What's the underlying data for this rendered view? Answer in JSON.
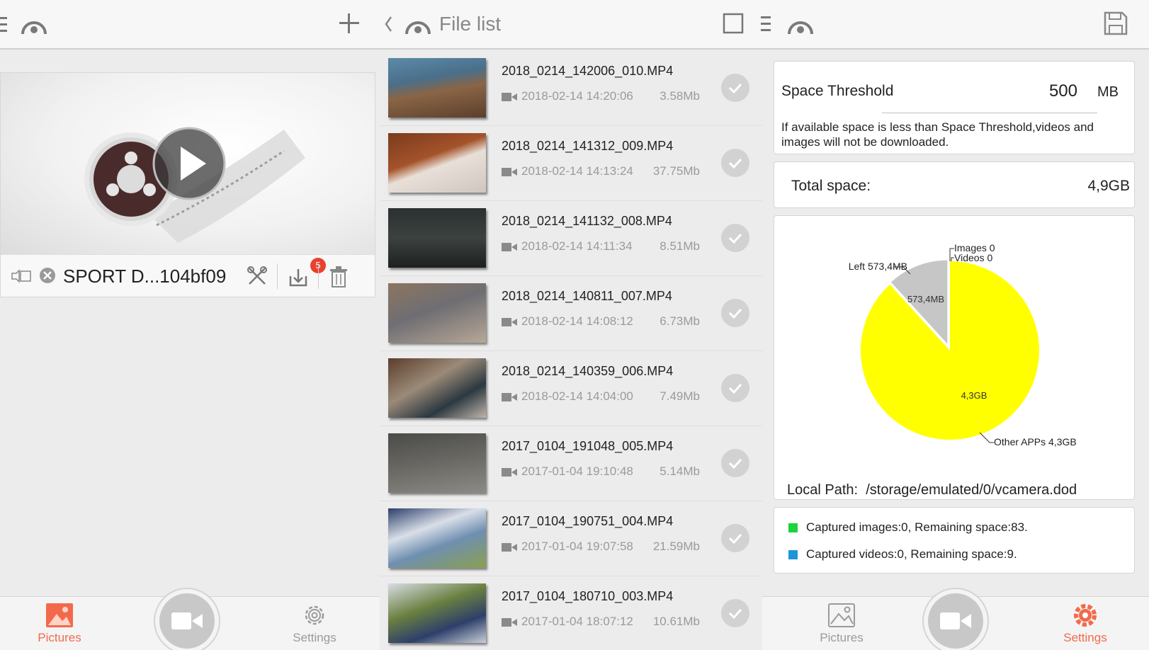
{
  "topbar": {
    "title": "File list"
  },
  "device": {
    "name": "SPORT D...104bf09",
    "badge_count": "5"
  },
  "files": [
    {
      "name": "2018_0214_142006_010.MP4",
      "date": "2018-02-14 14:20:06",
      "size": "3.58Mb"
    },
    {
      "name": "2018_0214_141312_009.MP4",
      "date": "2018-02-14 14:13:24",
      "size": "37.75Mb"
    },
    {
      "name": "2018_0214_141132_008.MP4",
      "date": "2018-02-14 14:11:34",
      "size": "8.51Mb"
    },
    {
      "name": "2018_0214_140811_007.MP4",
      "date": "2018-02-14 14:08:12",
      "size": "6.73Mb"
    },
    {
      "name": "2018_0214_140359_006.MP4",
      "date": "2018-02-14 14:04:00",
      "size": "7.49Mb"
    },
    {
      "name": "2017_0104_191048_005.MP4",
      "date": "2017-01-04 19:10:48",
      "size": "5.14Mb"
    },
    {
      "name": "2017_0104_190751_004.MP4",
      "date": "2017-01-04 19:07:58",
      "size": "21.59Mb"
    },
    {
      "name": "2017_0104_180710_003.MP4",
      "date": "2017-01-04 18:07:12",
      "size": "10.61Mb"
    }
  ],
  "settings": {
    "threshold_label": "Space Threshold",
    "threshold_value": "500",
    "threshold_unit": "MB",
    "threshold_desc": "If available space is less than Space Threshold,videos and images will not be downloaded.",
    "total_label": "Total space:",
    "total_value": "4,9GB",
    "local_path_label": "Local Path:",
    "local_path_value": "/storage/emulated/0/vcamera.dod",
    "legend_images": "Captured images:0, Remaining space:83.",
    "legend_videos": "Captured videos:0, Remaining space:9."
  },
  "chart_data": {
    "type": "pie",
    "slices": [
      {
        "label": "Images 0",
        "value": 0,
        "color": "#bdbdbd"
      },
      {
        "label": "Videos 0",
        "value": 0,
        "color": "#bdbdbd"
      },
      {
        "label": "Other APPs 4,3GB",
        "inner_label": "4,3GB",
        "value": 4.3,
        "color": "#ffff00"
      },
      {
        "label": "Left 573,4MB",
        "inner_label": "573,4MB",
        "value": 0.5734,
        "color": "#c6c6c6"
      }
    ]
  },
  "nav": {
    "pictures": "Pictures",
    "settings": "Settings"
  },
  "colors": {
    "accent": "#f26a4b",
    "pie_yellow": "#ffff00",
    "pie_gray": "#c6c6c6",
    "legend_images": "#19d43a",
    "legend_videos": "#1e95d8"
  }
}
